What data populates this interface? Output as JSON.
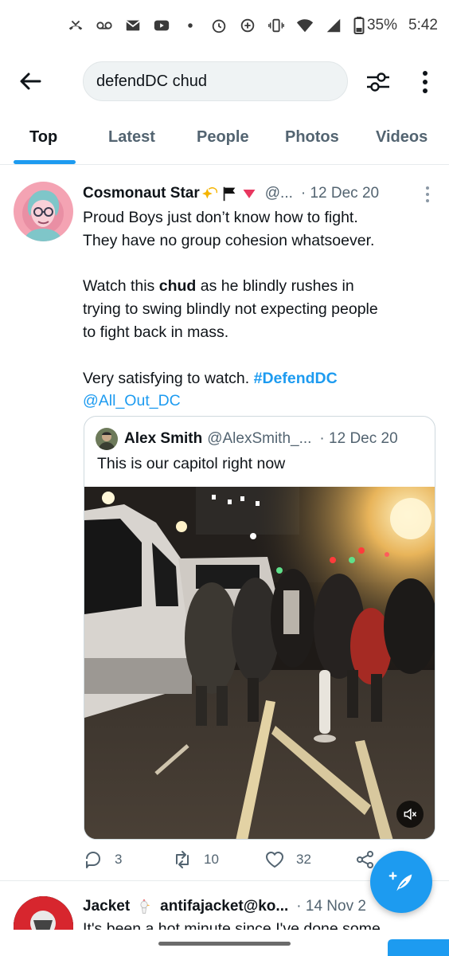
{
  "status_bar": {
    "battery": "35%",
    "time": "5:42",
    "left_icons": [
      "missed-call-icon",
      "voicemail-icon",
      "gmail-icon",
      "youtube-icon",
      "dot-icon"
    ],
    "right_icons": [
      "alarm-icon",
      "data-saver-icon",
      "vibrate-icon",
      "wifi-icon",
      "signal-icon",
      "battery-icon"
    ]
  },
  "header": {
    "search_query": "defendDC chud"
  },
  "tabs": [
    {
      "label": "Top",
      "active": true
    },
    {
      "label": "Latest"
    },
    {
      "label": "People"
    },
    {
      "label": "Photos"
    },
    {
      "label": "Videos"
    }
  ],
  "tweet": {
    "author_name": "Cosmonaut Star",
    "handle": "@...",
    "date": "· 12 Dec 20",
    "text_line1": "Proud Boys just don’t know how to fight.",
    "text_line2": "They have no group cohesion whatsoever.",
    "text_line3a": "Watch this ",
    "text_line3b": "chud",
    "text_line3c": " as he blindly rushes in",
    "text_line4": "trying to swing blindly not expecting people",
    "text_line5": "to fight back in mass.",
    "text_line6": "Very satisfying to watch. ",
    "hashtag": "#DefendDC",
    "mention": "@All_Out_DC",
    "quote": {
      "author_name": "Alex Smith",
      "handle": "@AlexSmith_...",
      "date": "· 12 Dec 20",
      "text": "This is our capitol right now"
    },
    "actions": {
      "replies": "3",
      "retweets": "10",
      "likes": "32"
    }
  },
  "tweet2": {
    "author_name": "Jacket",
    "handle": "antifajacket@ko...",
    "date": "· 14 Nov 2",
    "text": "It's been a hot minute since I've done some"
  },
  "colors": {
    "accent": "#1d9bf0",
    "text": "#0f1419",
    "muted": "#536471"
  }
}
